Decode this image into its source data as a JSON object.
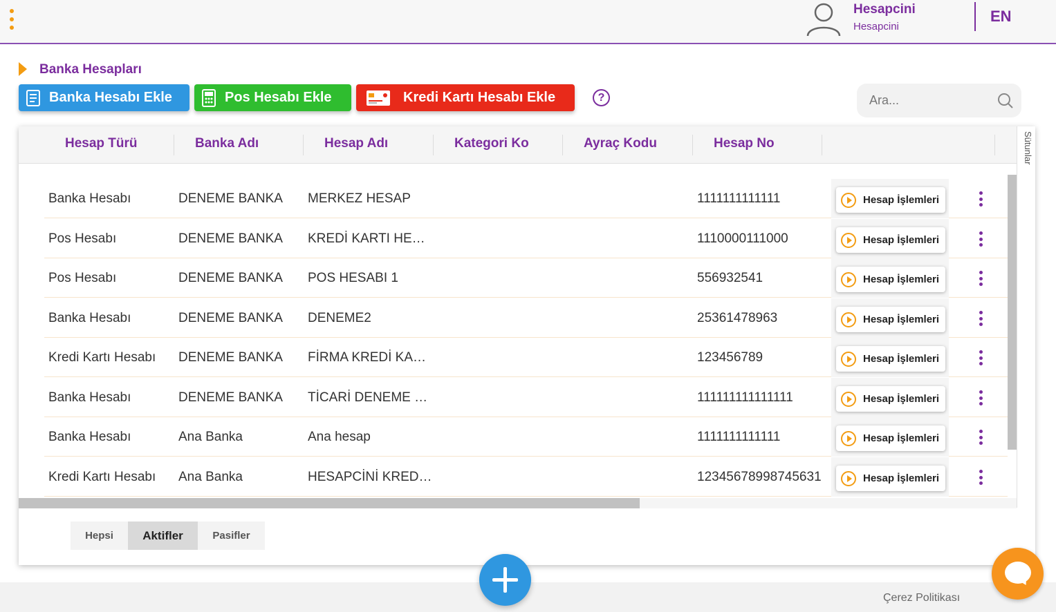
{
  "header": {
    "user_name": "Hesapcini",
    "user_subtitle": "Hesapcini",
    "language": "EN",
    "menu_icon": "kebab-menu-icon",
    "avatar_icon": "user-icon"
  },
  "breadcrumb": {
    "title": "Banka Hesapları"
  },
  "toolbar": {
    "add_bank_label": "Banka Hesabı Ekle",
    "add_pos_label": "Pos Hesabı Ekle",
    "add_credit_card_label": "Kredi Kartı Hesabı Ekle",
    "help_label": "?"
  },
  "search": {
    "placeholder": "Ara..."
  },
  "table": {
    "columns": [
      "Hesap Türü",
      "Banka Adı",
      "Hesap Adı",
      "Kategori Ko",
      "Ayraç Kodu",
      "Hesap No"
    ],
    "columns_toggle_label": "Sütunlar",
    "action_label": "Hesap İşlemleri",
    "rows": [
      {
        "type": "Banka Hesabı",
        "bank": "DENEME BANKA",
        "name": "MERKEZ HESAP",
        "category": "",
        "separator": "",
        "number": "1111111111111"
      },
      {
        "type": "Pos Hesabı",
        "bank": "DENEME BANKA",
        "name": "KREDİ KARTI HE…",
        "category": "",
        "separator": "",
        "number": "1110000111000"
      },
      {
        "type": "Pos Hesabı",
        "bank": "DENEME BANKA",
        "name": "POS HESABI 1",
        "category": "",
        "separator": "",
        "number": "556932541"
      },
      {
        "type": "Banka Hesabı",
        "bank": "DENEME BANKA",
        "name": "DENEME2",
        "category": "",
        "separator": "",
        "number": "25361478963"
      },
      {
        "type": "Kredi Kartı Hesabı",
        "bank": "DENEME BANKA",
        "name": "FİRMA KREDİ KA…",
        "category": "",
        "separator": "",
        "number": "123456789"
      },
      {
        "type": "Banka Hesabı",
        "bank": "DENEME BANKA",
        "name": "TİCARİ DENEME …",
        "category": "",
        "separator": "",
        "number": "111111111111111"
      },
      {
        "type": "Banka Hesabı",
        "bank": "Ana Banka",
        "name": "Ana hesap",
        "category": "",
        "separator": "",
        "number": "1111111111111"
      },
      {
        "type": "Kredi Kartı Hesabı",
        "bank": "Ana Banka",
        "name": "HESAPCİNİ KRED…",
        "category": "",
        "separator": "",
        "number": "12345678998745631"
      }
    ]
  },
  "filters": {
    "all": "Hepsi",
    "active": "Aktifler",
    "passive": "Pasifler",
    "selected": "Aktifler"
  },
  "footer": {
    "cookie_policy": "Çerez Politikası"
  },
  "colors": {
    "brand_purple": "#7b2d9e",
    "accent_orange": "#f39c12",
    "bank_blue": "#2f97e0",
    "pos_green": "#2fbd2f",
    "card_red": "#e82a1a"
  }
}
